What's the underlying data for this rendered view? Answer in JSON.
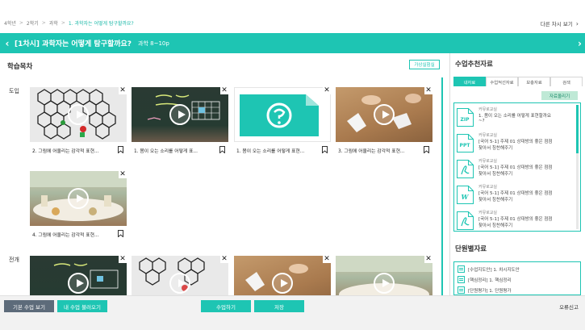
{
  "breadcrumb": {
    "items": [
      "4학년",
      "2학기",
      "과학",
      "1. 과학자는 어떻게 탐구할까요?"
    ],
    "other_view": "다른 차시 보기"
  },
  "titlebar": {
    "title": "[1차시] 과학자는 어떻게 탐구할까요?",
    "subtitle": "과학 8~10p"
  },
  "left": {
    "section_title": "학습목차",
    "virtual_button": "가상실험실",
    "stages": [
      "도입",
      "전개"
    ],
    "cards": [
      {
        "caption": "2. 그림에 어울리는 감각적 표현...",
        "thumb": "hex"
      },
      {
        "caption": "1. 봄이 오는 소리를 어떻게 표...",
        "thumb": "chalk"
      },
      {
        "caption": "1. 봄이 오는 소리를 어떻게 표현...",
        "thumb": "doc"
      },
      {
        "caption": "3. 그림에 어울리는 감각적 표현...",
        "thumb": "table"
      },
      {
        "caption": "4. 그림에 어울리는 감각적 표현...",
        "thumb": "garden"
      }
    ]
  },
  "right": {
    "title": "수업추천자료",
    "tabs": [
      "내자료",
      "수업적선자료",
      "보충자료",
      "검색"
    ],
    "upload": "자료올리기",
    "resources": [
      {
        "icon": "ZIP",
        "source": "커뮤로교실",
        "line1": "1. 봄이 오는 소리를 어떻게 표현할까요",
        "line2": "~?"
      },
      {
        "icon": "PPT",
        "source": "커뮤로교실",
        "line1": "[국어 5-1] 주제 01 상대방의 좋은 점점",
        "line2": "찾아서 칭찬해주기"
      },
      {
        "icon": "PDF",
        "source": "커뮤로교실",
        "line1": "[국어 5-1] 주제 01 상대방의 좋은 점점",
        "line2": "찾아서 칭찬해주기"
      },
      {
        "icon": "W",
        "source": "커뮤로교실",
        "line1": "[국어 5-1] 주제 01 상대방의 좋은 점점",
        "line2": "찾아서 칭찬해주기"
      },
      {
        "icon": "PDF",
        "source": "커뮤로교실",
        "line1": "[국어 5-1] 주제 01 상대방의 좋은 점점",
        "line2": "찾아서 칭찬해주기"
      }
    ],
    "unit_title": "단원별자료",
    "unit_items": [
      "[수업지도안] 1. 차시지도안",
      "[핵심정리] 1. 핵심정리",
      "[단원평가] 1. 단원평가"
    ]
  },
  "bottombar": {
    "basic": "기본 수업 보기",
    "mine": "내 수업 불러오기",
    "start": "수업하기",
    "save": "저장",
    "report": "오류신고"
  },
  "colors": {
    "accent": "#1ec5b3",
    "dark_button": "#5d6b7a"
  }
}
